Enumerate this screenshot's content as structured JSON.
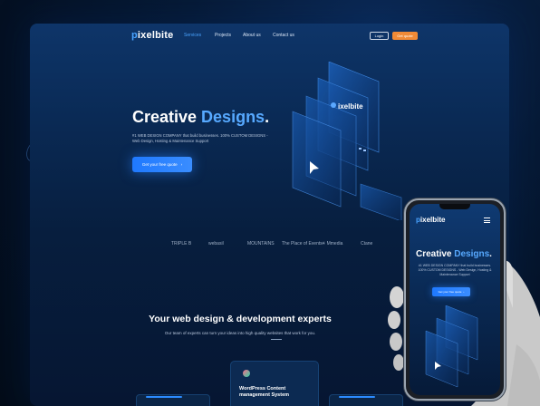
{
  "brand": {
    "logo_mark": "p",
    "logo_text": "ixelbite",
    "mock_logo_text": "ixelbite"
  },
  "nav": {
    "items": [
      {
        "label": "Services",
        "active": true
      },
      {
        "label": "Projects",
        "active": false
      },
      {
        "label": "About us",
        "active": false
      },
      {
        "label": "Contact us",
        "active": false
      }
    ],
    "login_label": "Login",
    "quote_label": "Get quote"
  },
  "hero": {
    "title_plain": "Creative ",
    "title_highlight": "Designs",
    "title_end": ".",
    "subtitle": "#1 WEB DESIGN COMPANY that build businesses. 100% CUSTOM DESIGNS - Web Design, Hosting & Maintenance Support",
    "cta_label": "Get your free quote",
    "cta_icon": "chevron-right-icon"
  },
  "brands": [
    "TRIPLE B",
    "webasil",
    "MOUNTAINS",
    "The Place of Events",
    "✳ Mmedia",
    "Ctane"
  ],
  "section": {
    "title": "Your web design & development experts",
    "subtitle": "Our team of experts can turn your ideas into high quality websites that work for you."
  },
  "service_card": {
    "title": "WordPress Content management System"
  },
  "phone": {
    "logo_mark": "p",
    "logo_text": "ixelbite",
    "title_plain": "Creative ",
    "title_highlight": "Designs",
    "title_end": ".",
    "subtitle": "#1 WEB DESIGN COMPANY that build businesses. 100% CUSTOM DESIGNS - Web Design, Hosting & Maintenance Support",
    "cta_label": "Get your free quote"
  },
  "colors": {
    "accent": "#57a9ff",
    "cta": "#1f79ff",
    "quote": "#f08a36",
    "background": "#061a36"
  }
}
